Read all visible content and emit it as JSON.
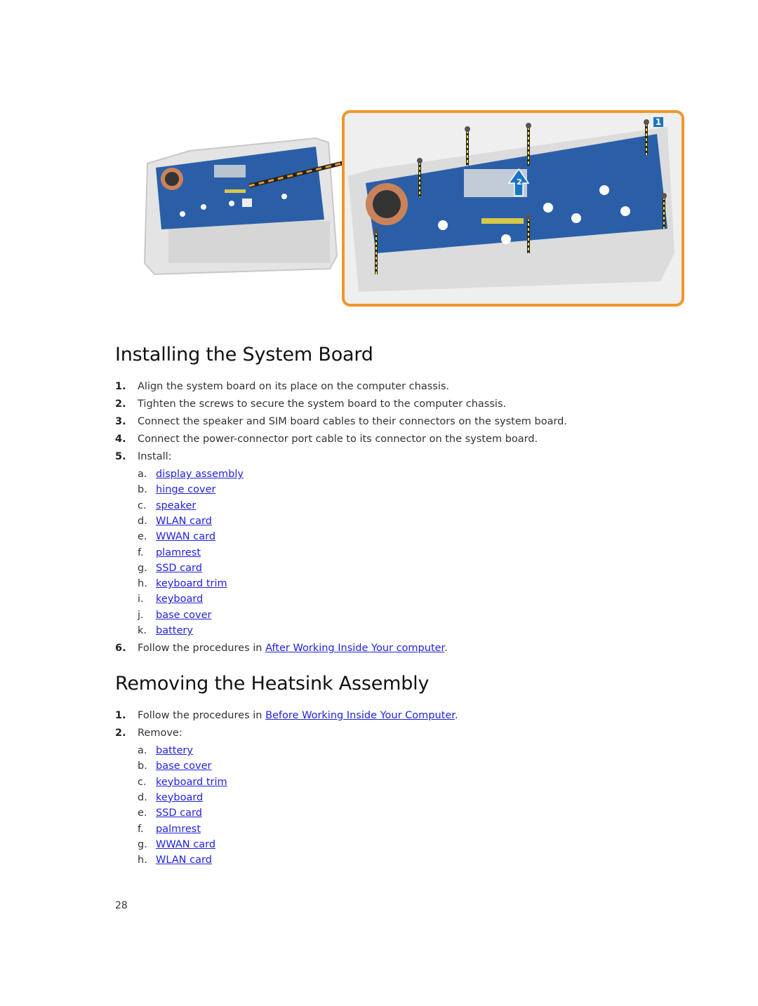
{
  "figure": {
    "callout_badges": [
      "1",
      "2"
    ],
    "colors": {
      "callout_border": "#f0962a",
      "badge": "#1c75c0",
      "board": "#2a5fa8"
    }
  },
  "section1": {
    "title": "Installing the System Board",
    "steps": [
      {
        "num": "1.",
        "text": "Align the system board on its place on the computer chassis."
      },
      {
        "num": "2.",
        "text": "Tighten the screws to secure the system board to the computer chassis."
      },
      {
        "num": "3.",
        "text": "Connect the speaker and SIM board cables to their connectors on the system board."
      },
      {
        "num": "4.",
        "text": "Connect the power-connector port cable to its connector on the system board."
      },
      {
        "num": "5.",
        "text": "Install:"
      },
      {
        "num": "6.",
        "prefix": "Follow the procedures in ",
        "link": "After Working Inside Your computer",
        "suffix": "."
      }
    ],
    "install_items": [
      {
        "letter": "a.",
        "label": "display assembly"
      },
      {
        "letter": "b.",
        "label": "hinge cover"
      },
      {
        "letter": "c.",
        "label": "speaker"
      },
      {
        "letter": "d.",
        "label": "WLAN card"
      },
      {
        "letter": "e.",
        "label": "WWAN card"
      },
      {
        "letter": "f.",
        "label": "plamrest"
      },
      {
        "letter": "g.",
        "label": "SSD card"
      },
      {
        "letter": "h.",
        "label": "keyboard trim"
      },
      {
        "letter": "i.",
        "label": "keyboard"
      },
      {
        "letter": "j.",
        "label": "base cover"
      },
      {
        "letter": "k.",
        "label": "battery"
      }
    ]
  },
  "section2": {
    "title": "Removing the Heatsink Assembly",
    "steps": [
      {
        "num": "1.",
        "prefix": "Follow the procedures in ",
        "link": "Before Working Inside Your Computer",
        "suffix": "."
      },
      {
        "num": "2.",
        "text": "Remove:"
      }
    ],
    "remove_items": [
      {
        "letter": "a.",
        "label": "battery"
      },
      {
        "letter": "b.",
        "label": "base cover"
      },
      {
        "letter": "c.",
        "label": "keyboard trim"
      },
      {
        "letter": "d.",
        "label": "keyboard"
      },
      {
        "letter": "e.",
        "label": "SSD card"
      },
      {
        "letter": "f.",
        "label": "palmrest"
      },
      {
        "letter": "g.",
        "label": "WWAN card"
      },
      {
        "letter": "h.",
        "label": "WLAN card"
      }
    ]
  },
  "page_number": "28"
}
